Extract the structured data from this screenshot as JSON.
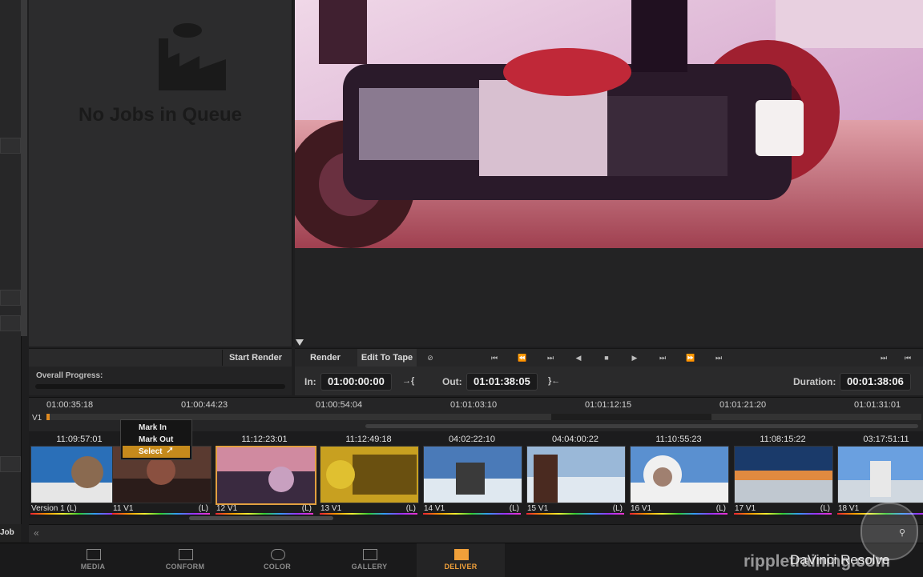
{
  "queue": {
    "empty_text": "No Jobs in Queue",
    "start_render_label": "Start Render",
    "progress_label": "Overall Progress:",
    "job_label": "Job"
  },
  "viewer": {
    "tabs": [
      "Render",
      "Edit To Tape"
    ],
    "in_label": "In:",
    "in_value": "01:00:00:00",
    "out_label": "Out:",
    "out_value": "01:01:38:05",
    "duration_label": "Duration:",
    "duration_value": "00:01:38:06"
  },
  "timeline": {
    "track_label": "V1",
    "ruler": [
      "01:00:35:18",
      "01:00:44:23",
      "01:00:54:04",
      "01:01:03:10",
      "01:01:12:15",
      "01:01:21:20",
      "01:01:31:01"
    ]
  },
  "clips": [
    {
      "tc": "11:09:57:01",
      "name": "Version 1 (L)",
      "flag": "",
      "colors": [
        "#2a6fb8",
        "#e6e6e6",
        "#8a6a50"
      ]
    },
    {
      "tc": "",
      "name": "11 V1",
      "flag": "(L)",
      "colors": [
        "#5a3a30",
        "#2b1c1a",
        "#8a5040"
      ]
    },
    {
      "tc": "11:12:23:01",
      "name": "12 V1",
      "flag": "(L)",
      "colors": [
        "#d08aa0",
        "#3a2a40",
        "#c8a0c0"
      ]
    },
    {
      "tc": "11:12:49:18",
      "name": "13 V1",
      "flag": "(L)",
      "colors": [
        "#c8a020",
        "#6a5010",
        "#e0c030"
      ]
    },
    {
      "tc": "04:02:22:10",
      "name": "14 V1",
      "flag": "(L)",
      "colors": [
        "#4a7ab8",
        "#dfe8f0",
        "#3a3a3a"
      ]
    },
    {
      "tc": "04:04:00:22",
      "name": "15 V1",
      "flag": "(L)",
      "colors": [
        "#9ab8d8",
        "#4a2a20",
        "#e0e8f0"
      ]
    },
    {
      "tc": "11:10:55:23",
      "name": "16 V1",
      "flag": "(L)",
      "colors": [
        "#5a90d0",
        "#f0f0f0",
        "#a08070"
      ]
    },
    {
      "tc": "11:08:15:22",
      "name": "17 V1",
      "flag": "(L)",
      "colors": [
        "#1a3a6a",
        "#e08a40",
        "#c0c8d0"
      ]
    },
    {
      "tc": "03:17:51:11",
      "name": "18 V1",
      "flag": "",
      "colors": [
        "#6aa0e0",
        "#e8e8e8",
        "#d0d8e0"
      ]
    }
  ],
  "context_menu": [
    "Mark In",
    "Mark Out",
    "Select"
  ],
  "nav": [
    {
      "label": "MEDIA",
      "icon": "film-icon"
    },
    {
      "label": "CONFORM",
      "icon": "timeline-icon"
    },
    {
      "label": "COLOR",
      "icon": "color-wheel-icon"
    },
    {
      "label": "GALLERY",
      "icon": "gallery-icon"
    },
    {
      "label": "DELIVER",
      "icon": "truck-icon"
    }
  ],
  "brand": "DaVinci Resolve",
  "watermark": "rippletraining.com",
  "accent": "#f0a03a"
}
